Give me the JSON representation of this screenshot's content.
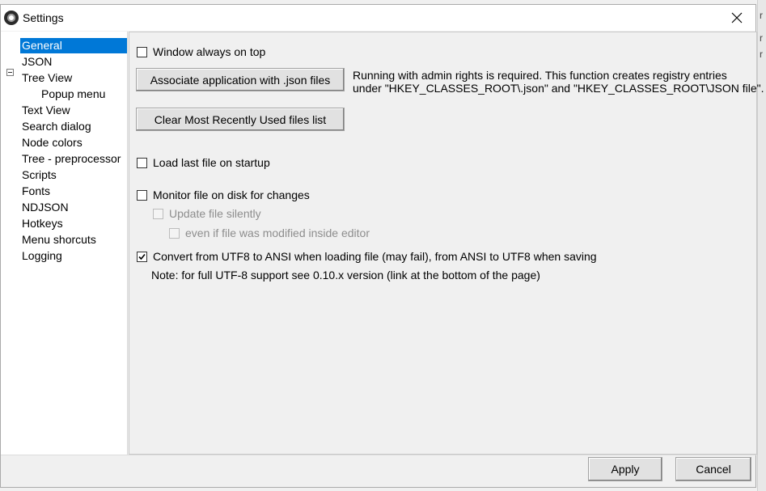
{
  "window": {
    "title": "Settings"
  },
  "tree": {
    "items": [
      {
        "label": "General"
      },
      {
        "label": "JSON"
      },
      {
        "label": "Tree View"
      },
      {
        "label": "Popup menu"
      },
      {
        "label": "Text View"
      },
      {
        "label": "Search dialog"
      },
      {
        "label": "Node colors"
      },
      {
        "label": "Tree - preprocessor"
      },
      {
        "label": "Scripts"
      },
      {
        "label": "Fonts"
      },
      {
        "label": "NDJSON"
      },
      {
        "label": "Hotkeys"
      },
      {
        "label": "Menu shorcuts"
      },
      {
        "label": "Logging"
      }
    ],
    "selected": "General",
    "selection_color": "#0078d7"
  },
  "general": {
    "always_on_top": {
      "label": "Window always on top",
      "checked": false
    },
    "associate_button": "Associate application with .json files",
    "associate_info_line1": "Running with admin rights is required. This function creates registry entries",
    "associate_info_line2": "under \"HKEY_CLASSES_ROOT\\.json\" and \"HKEY_CLASSES_ROOT\\JSON file\".",
    "clear_mru_button": "Clear Most Recently Used files list",
    "load_last_file": {
      "label": "Load last file on startup",
      "checked": false
    },
    "monitor_file": {
      "label": "Monitor file on disk for changes",
      "checked": false
    },
    "update_silently": {
      "label": "Update file silently",
      "checked": false,
      "enabled": false
    },
    "even_if_modified": {
      "label": "even if file was modified inside editor",
      "checked": false,
      "enabled": false
    },
    "convert_utf8": {
      "label": "Convert from UTF8 to ANSI when loading file (may fail), from ANSI to UTF8 when saving",
      "checked": true
    },
    "utf8_note": "Note: for full UTF-8 support see 0.10.x version (link at the bottom of the page)"
  },
  "footer": {
    "apply": "Apply",
    "cancel": "Cancel"
  },
  "background_fragments": {
    "r1": "r",
    "r2": "r",
    "r3": "r"
  }
}
